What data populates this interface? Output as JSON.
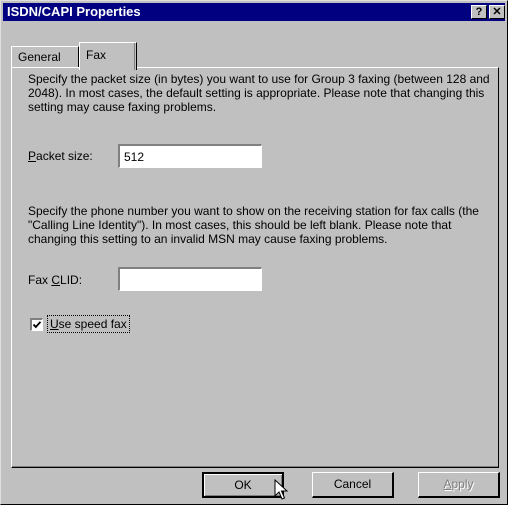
{
  "window": {
    "title": "ISDN/CAPI Properties",
    "help_glyph": "?",
    "close_glyph": "✕"
  },
  "tabs": [
    {
      "label": "General",
      "active": false
    },
    {
      "label": "Fax",
      "active": true
    }
  ],
  "fax": {
    "packet_desc": "Specify the packet size (in bytes) you want to use for Group 3 faxing (between 128 and 2048). In most cases, the default setting is appropriate. Please note that changing this setting may cause faxing problems.",
    "packet_label_key": "P",
    "packet_label_rest": "acket size:",
    "packet_value": "512",
    "clid_desc": "Specify the phone number you want to show on the receiving station for fax calls (the \"Calling Line Identity\"). In most cases, this should be left blank. Please note that changing this setting to an invalid MSN may cause faxing problems.",
    "clid_label_pre": "Fax ",
    "clid_label_key": "C",
    "clid_label_rest": "LID:",
    "clid_value": "",
    "speed_fax_key": "U",
    "speed_fax_rest": "se speed fax",
    "speed_fax_checked": true
  },
  "buttons": {
    "ok": "OK",
    "cancel": "Cancel",
    "apply_key": "A",
    "apply_rest": "pply",
    "apply_enabled": false
  },
  "colors": {
    "titlebar": "#000080",
    "face": "#c0c0c0"
  }
}
